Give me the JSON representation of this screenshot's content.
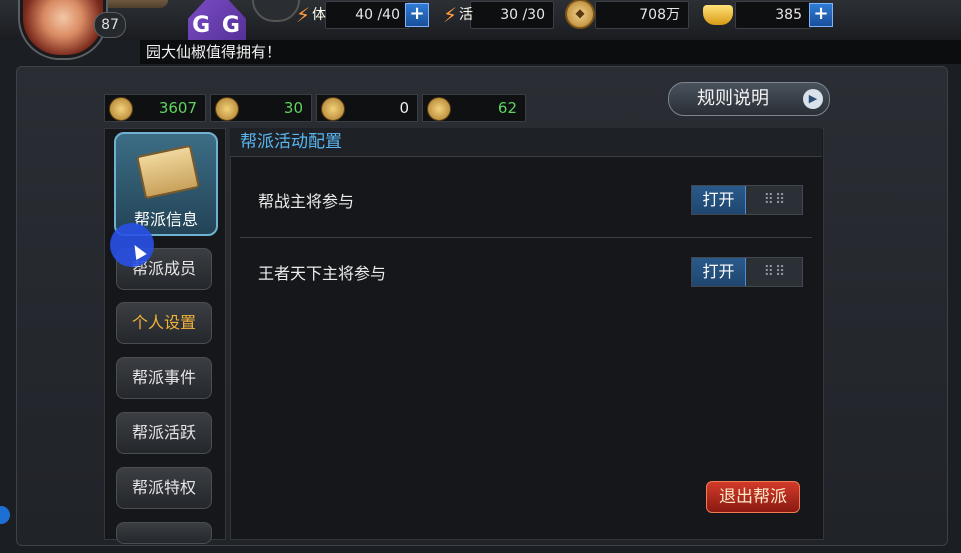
{
  "header": {
    "player_level": "87",
    "stamina": {
      "label": "体",
      "value": "40 /40"
    },
    "vitality": {
      "label": "活",
      "value": "30 /30"
    },
    "coins": "708万",
    "gold": "385",
    "gg_label": "G G"
  },
  "marquee": {
    "text": "园大仙椒值得拥有！"
  },
  "resources": [
    "3607",
    "30",
    "0",
    "62"
  ],
  "rules_button": {
    "label": "规则说明",
    "arrow": "▶"
  },
  "sidebar": {
    "items": [
      {
        "label": "帮派信息"
      },
      {
        "label": "帮派成员"
      },
      {
        "label": "个人设置"
      },
      {
        "label": "帮派事件"
      },
      {
        "label": "帮派活跃"
      },
      {
        "label": "帮派特权"
      }
    ]
  },
  "content": {
    "title": "帮派活动配置",
    "settings": [
      {
        "label": "帮战主将参与",
        "toggle_on": "打开",
        "knob": "⠿⠿"
      },
      {
        "label": "王者天下主将参与",
        "toggle_on": "打开",
        "knob": "⠿⠿"
      }
    ]
  },
  "quit_button": {
    "label": "退出帮派"
  }
}
